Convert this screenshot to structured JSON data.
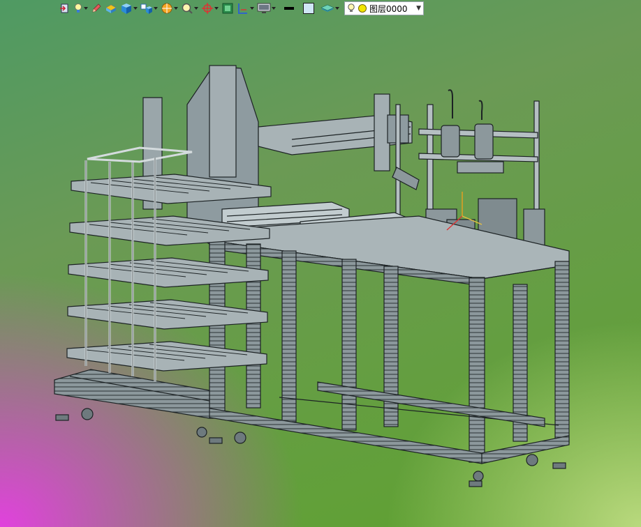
{
  "toolbar": {
    "tools": [
      {
        "icon": "exit-door-icon",
        "dropdown": false
      },
      {
        "icon": "light-bulb-icon",
        "dropdown": true
      },
      {
        "icon": "pencil-icon",
        "dropdown": false
      },
      {
        "icon": "extrude-block-icon",
        "dropdown": false
      },
      {
        "icon": "cube-view-icon",
        "dropdown": true
      },
      {
        "icon": "multi-view-icon",
        "dropdown": true
      },
      {
        "icon": "render-style-icon",
        "dropdown": true
      },
      {
        "icon": "zoom-icon",
        "dropdown": true
      },
      {
        "icon": "compass-icon",
        "dropdown": true
      },
      {
        "icon": "fit-view-icon",
        "dropdown": false
      },
      {
        "icon": "section-plane-icon",
        "dropdown": true
      },
      {
        "icon": "monitor-icon",
        "dropdown": true
      },
      {
        "icon": "line-weight-icon",
        "dropdown": false
      },
      {
        "icon": "color-swatch-icon",
        "dropdown": false
      },
      {
        "icon": "layer-stack-icon",
        "dropdown": true
      }
    ],
    "layer": {
      "name": "图层0000",
      "status_color": "#f2e600"
    }
  },
  "colors": {
    "model_fill": "#9aa6aa",
    "model_edge": "#1c2224",
    "model_dark": "#6e7a7e"
  }
}
